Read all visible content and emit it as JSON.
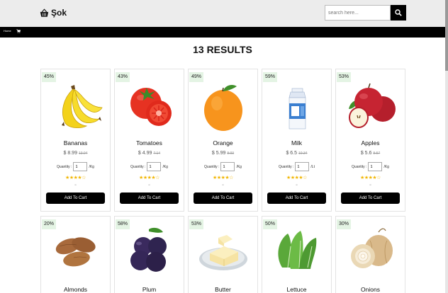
{
  "header": {
    "brand": "Şok",
    "search_placeholder": "search here...",
    "search_value": ""
  },
  "nav": {
    "home_label": "Home"
  },
  "results": {
    "title": "13 RESULTS"
  },
  "labels": {
    "quantity": "Quantity :",
    "add_to_cart": "Add To Cart"
  },
  "products": [
    {
      "name": "Bananas",
      "discount": "45%",
      "price": "$ 8.99",
      "old_price": "13.04",
      "qty": "1",
      "unit": "/Kg",
      "stars": "★★★★☆"
    },
    {
      "name": "Tomatoes",
      "discount": "43%",
      "price": "$ 4.99",
      "old_price": "7.14",
      "qty": "1",
      "unit": "/Kg",
      "stars": "★★★★☆"
    },
    {
      "name": "Orange",
      "discount": "49%",
      "price": "$ 5.99",
      "old_price": "8.93",
      "qty": "1",
      "unit": "/Kg",
      "stars": "★★★★☆"
    },
    {
      "name": "Milk",
      "discount": "59%",
      "price": "$ 6.5",
      "old_price": "10.34",
      "qty": "1",
      "unit": "/Lt",
      "stars": "★★★★☆"
    },
    {
      "name": "Apples",
      "discount": "53%",
      "price": "$ 5.6",
      "old_price": "8.57",
      "qty": "1",
      "unit": "/Kg",
      "stars": "★★★★☆"
    },
    {
      "name": "Almonds",
      "discount": "20%"
    },
    {
      "name": "Plum",
      "discount": "58%"
    },
    {
      "name": "Butter",
      "discount": "53%"
    },
    {
      "name": "Lettuce",
      "discount": "50%"
    },
    {
      "name": "Onions",
      "discount": "30%"
    }
  ],
  "icons": {
    "brand": "basket-icon",
    "search": "search-icon",
    "nav_cart": "cart-icon"
  },
  "colors": {
    "header_bg": "#ececec",
    "nav_bg": "#000000",
    "badge_bg": "#e4f4e4",
    "button_bg": "#000000",
    "star": "#f2b705"
  }
}
